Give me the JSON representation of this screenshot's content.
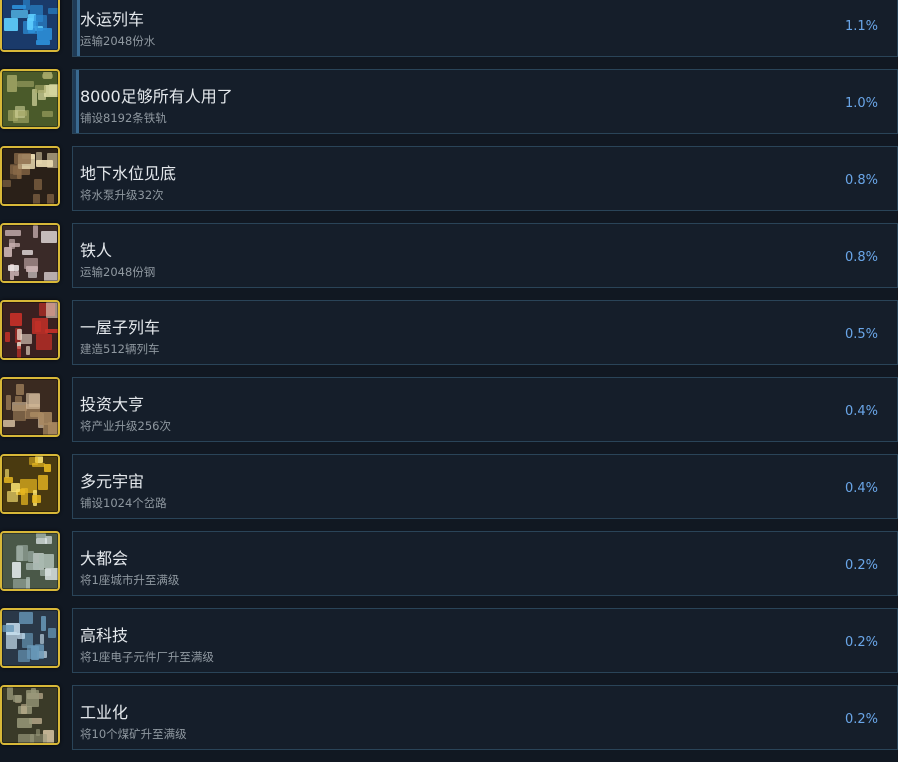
{
  "achievements": [
    {
      "title": "水运列车",
      "desc": "运输2048份水",
      "percent": "1.1%",
      "progress": 0.011,
      "icon": "water-train-icon",
      "colors": [
        "#1a3a6a",
        "#2c8fd8",
        "#5fd0ff"
      ]
    },
    {
      "title": "8000足够所有人用了",
      "desc": "铺设8192条铁轨",
      "percent": "1.0%",
      "progress": 0.01,
      "icon": "railway-tracks-icon",
      "colors": [
        "#4a5a2a",
        "#a6a868",
        "#d8d8a0"
      ]
    },
    {
      "title": "地下水位见底",
      "desc": "将水泵升级32次",
      "percent": "0.8%",
      "progress": 0,
      "icon": "water-pump-icon",
      "colors": [
        "#2a2018",
        "#8a6a48",
        "#e8d8b0"
      ]
    },
    {
      "title": "铁人",
      "desc": "运输2048份钢",
      "percent": "0.8%",
      "progress": 0,
      "icon": "steel-cargo-icon",
      "colors": [
        "#3a2a28",
        "#c8b0b0",
        "#f0e8e8"
      ]
    },
    {
      "title": "一屋子列车",
      "desc": "建造512辆列车",
      "percent": "0.5%",
      "progress": 0,
      "icon": "locomotive-icon",
      "colors": [
        "#3a2020",
        "#c83028",
        "#e8d8c8"
      ]
    },
    {
      "title": "投资大亨",
      "desc": "将产业升级256次",
      "percent": "0.4%",
      "progress": 0,
      "icon": "industry-upgrade-icon",
      "colors": [
        "#3a2a20",
        "#a88860",
        "#d8c0a0"
      ]
    },
    {
      "title": "多元宇宙",
      "desc": "铺设1024个岔路",
      "percent": "0.4%",
      "progress": 0,
      "icon": "rail-switch-icon",
      "colors": [
        "#4a3a10",
        "#e8b820",
        "#f8e070"
      ]
    },
    {
      "title": "大都会",
      "desc": "将1座城市升至满级",
      "percent": "0.2%",
      "progress": 0,
      "icon": "metropolis-icon",
      "colors": [
        "#4a5848",
        "#a8b8b0",
        "#e0e8e8"
      ]
    },
    {
      "title": "高科技",
      "desc": "将1座电子元件厂升至满级",
      "percent": "0.2%",
      "progress": 0,
      "icon": "electronics-factory-icon",
      "colors": [
        "#2a3848",
        "#6898b8",
        "#c8e0f0"
      ]
    },
    {
      "title": "工业化",
      "desc": "将10个煤矿升至满级",
      "percent": "0.2%",
      "progress": 0,
      "icon": "coal-mine-icon",
      "colors": [
        "#3a3a28",
        "#98987a",
        "#c8b898"
      ]
    }
  ]
}
